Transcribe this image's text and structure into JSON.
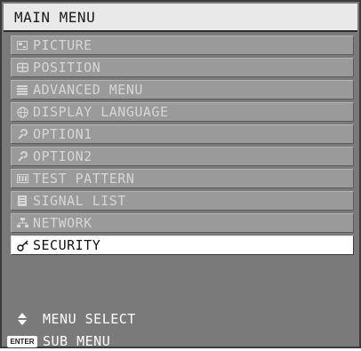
{
  "header": {
    "title": "MAIN MENU"
  },
  "menu": {
    "items": [
      {
        "label": "PICTURE",
        "icon": "picture-icon",
        "selected": false
      },
      {
        "label": "POSITION",
        "icon": "position-icon",
        "selected": false
      },
      {
        "label": "ADVANCED MENU",
        "icon": "advanced-menu-icon",
        "selected": false
      },
      {
        "label": "DISPLAY LANGUAGE",
        "icon": "globe-icon",
        "selected": false
      },
      {
        "label": "OPTION1",
        "icon": "wrench-icon",
        "selected": false
      },
      {
        "label": "OPTION2",
        "icon": "wrench-icon",
        "selected": false
      },
      {
        "label": "TEST PATTERN",
        "icon": "test-pattern-icon",
        "selected": false
      },
      {
        "label": "SIGNAL LIST",
        "icon": "signal-list-icon",
        "selected": false
      },
      {
        "label": "NETWORK",
        "icon": "network-icon",
        "selected": false
      },
      {
        "label": "SECURITY",
        "icon": "key-icon",
        "selected": true
      }
    ]
  },
  "footer": {
    "menu_select_label": "MENU SELECT",
    "menu_select_icon": "up-down-arrows-icon",
    "sub_menu_label": "SUB MENU",
    "enter_key_label": "ENTER"
  },
  "colors": {
    "panel_background": "#7a7a7a",
    "item_background": "#9a9a9a",
    "item_text": "#d6d6d6",
    "selected_background": "#ffffff",
    "selected_text": "#111111",
    "header_background": "#e9e9e9"
  }
}
